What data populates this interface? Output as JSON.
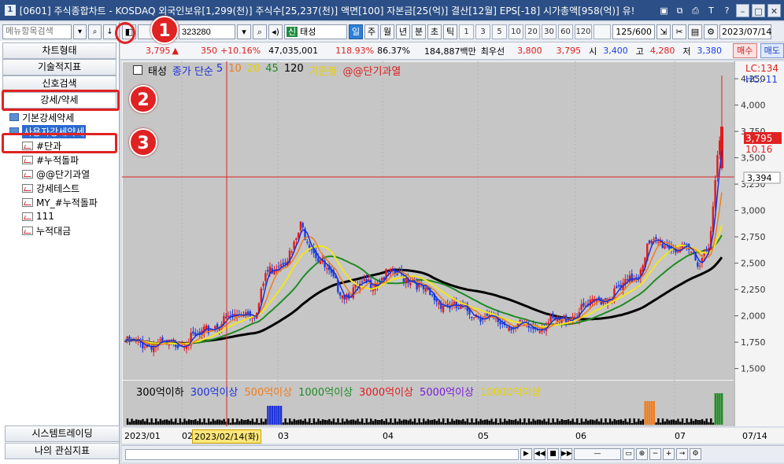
{
  "window": {
    "title": "[0601] 주식종합차트 - KOSDAQ 외국인보유[1,299(천)] 주식수[25,237(천)] 액면[100] 자본금[25(억)] 결산[12월] EPS[-18] 시가총액[958(억)] 유!",
    "icon_label": "1"
  },
  "left_panel": {
    "search_placeholder": "메뉴항목검색",
    "menu": [
      "차트형태",
      "기술적지표",
      "신호검색",
      "강세/약세"
    ],
    "tree": {
      "folder1": "기본강세약세",
      "folder2": "사용자강세약세",
      "items": [
        "#단과",
        "#누적돌파",
        "@@단기과열",
        "강세테스트",
        "MY_#누적돌파",
        "111",
        "누적대금"
      ]
    },
    "bottom_menu": [
      "시스템트레이딩",
      "나의 관심지표"
    ]
  },
  "toolbar": {
    "code": "323280",
    "stock_sin": "신",
    "stock_name": "태성",
    "periods": [
      "일",
      "주",
      "월",
      "년",
      "분",
      "초",
      "틱"
    ],
    "active_period": "일",
    "numbers": [
      "1",
      "3",
      "5",
      "10",
      "20",
      "30",
      "60",
      "120"
    ],
    "count": "125/600",
    "date": "2023/07/14"
  },
  "quote": {
    "price": "3,795",
    "change": "350",
    "change_pct": "+10.16%",
    "volume": "47,035,001",
    "vol_ratio": "118.93%",
    "turnover": "86.37%",
    "amount": "184,887백만",
    "best_label": "최우선",
    "best_ask": "3,800",
    "best_bid": "3,795",
    "open_label": "시",
    "open": "3,400",
    "high_label": "고",
    "high": "4,280",
    "low_label": "저",
    "low": "3,380",
    "buy": "매수",
    "sell": "매도"
  },
  "chart_legend": {
    "name": "태성",
    "price_type": "종가 단순",
    "ma5": "5",
    "ma10": "10",
    "ma20": "20",
    "ma45": "45",
    "ma120": "120",
    "base": "기준봉",
    "signal": "@@단기과열"
  },
  "price_axis": {
    "ticks": [
      "4,250",
      "4,000",
      "3,750",
      "3,500",
      "3,250",
      "3,000",
      "2,750",
      "2,500",
      "2,250",
      "2,000",
      "1,750",
      "1,500"
    ],
    "lc": "LC:134",
    "hc": "HC:-11",
    "last_price": "3,795",
    "last_pct": "10.16",
    "cursor_price": "3,394"
  },
  "volume_legend": [
    "300억이하",
    "300억이상",
    "500억이상",
    "1000억이상",
    "3000억이상",
    "5000억이상",
    "10000억이상"
  ],
  "date_axis": {
    "labels": [
      "2023/01",
      "02",
      "03",
      "04",
      "05",
      "06",
      "07",
      "07/14"
    ],
    "cursor_date": "2023/02/14(화)"
  },
  "colors": {
    "up": "#e01b1b",
    "down": "#1b3fe0",
    "ma5": "#1b2fd8",
    "ma10": "#f07d1a",
    "ma20": "#f2e51b",
    "ma45": "#1f8b23",
    "ma120": "#000000",
    "chart_bg": "#c6c6c6"
  },
  "annotations": [
    "1",
    "2",
    "3"
  ],
  "chart_data": {
    "type": "candlestick",
    "ylim": [
      1400,
      4400
    ],
    "last": {
      "open": 3400,
      "high": 4280,
      "low": 3380,
      "close": 3795
    }
  }
}
